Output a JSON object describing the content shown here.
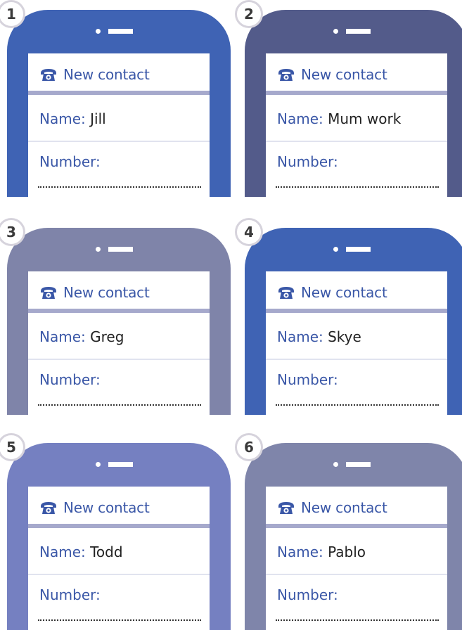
{
  "colors": {
    "title_blue": "#3a57a7",
    "phone_1": "#3f63b4",
    "phone_2": "#535b8a",
    "phone_3": "#7f84a9",
    "phone_4": "#3f63b4",
    "phone_5": "#7580c1",
    "phone_6": "#7f85aa"
  },
  "cards": [
    {
      "number": "1",
      "title": "New contact",
      "name_label": "Name:",
      "name_value": "Jill",
      "number_label": "Number:"
    },
    {
      "number": "2",
      "title": "New contact",
      "name_label": "Name:",
      "name_value": "Mum work",
      "number_label": "Number:"
    },
    {
      "number": "3",
      "title": "New contact",
      "name_label": "Name:",
      "name_value": "Greg",
      "number_label": "Number:"
    },
    {
      "number": "4",
      "title": "New contact",
      "name_label": "Name:",
      "name_value": "Skye",
      "number_label": "Number:"
    },
    {
      "number": "5",
      "title": "New contact",
      "name_label": "Name:",
      "name_value": "Todd",
      "number_label": "Number:"
    },
    {
      "number": "6",
      "title": "New contact",
      "name_label": "Name:",
      "name_value": "Pablo",
      "number_label": "Number:"
    }
  ],
  "icons": {
    "title": "telephone-icon"
  }
}
